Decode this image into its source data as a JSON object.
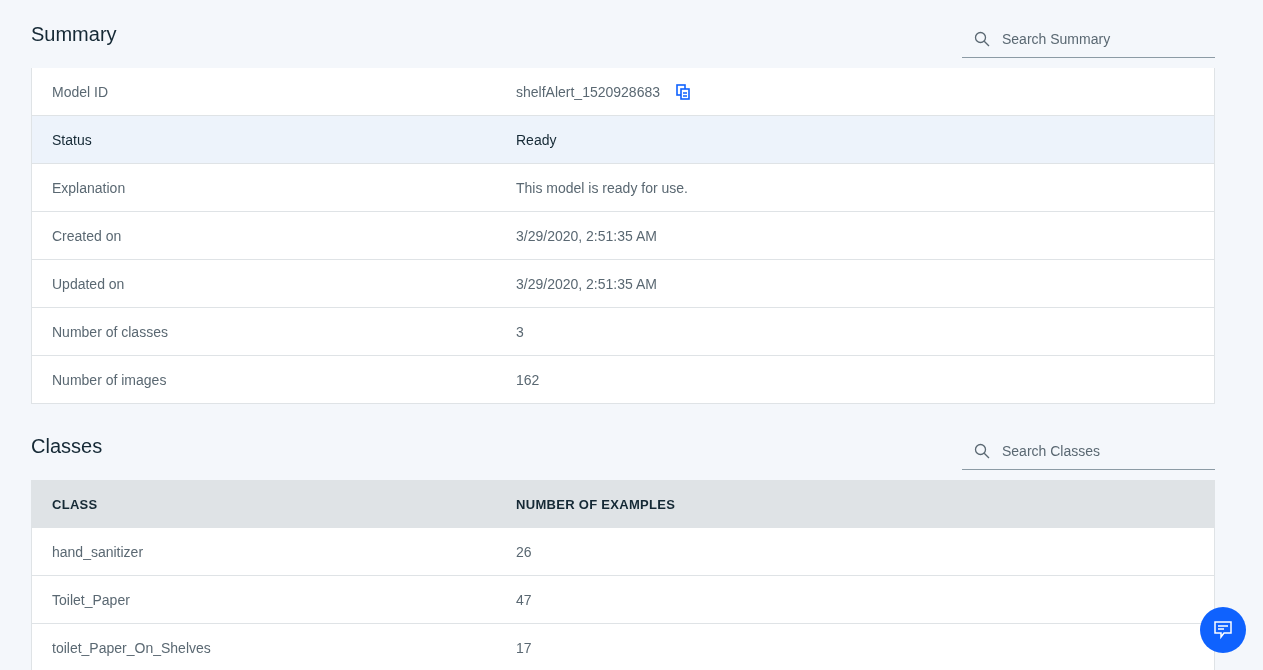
{
  "summary": {
    "title": "Summary",
    "search": {
      "placeholder": "Search Summary"
    },
    "rows": [
      {
        "label": "Model ID",
        "value": "shelfAlert_1520928683",
        "copyable": true,
        "selected": false
      },
      {
        "label": "Status",
        "value": "Ready",
        "copyable": false,
        "selected": true
      },
      {
        "label": "Explanation",
        "value": "This model is ready for use.",
        "copyable": false,
        "selected": false
      },
      {
        "label": "Created on",
        "value": "3/29/2020, 2:51:35 AM",
        "copyable": false,
        "selected": false
      },
      {
        "label": "Updated on",
        "value": "3/29/2020, 2:51:35 AM",
        "copyable": false,
        "selected": false
      },
      {
        "label": "Number of classes",
        "value": "3",
        "copyable": false,
        "selected": false
      },
      {
        "label": "Number of images",
        "value": "162",
        "copyable": false,
        "selected": false
      }
    ]
  },
  "classes": {
    "title": "Classes",
    "search": {
      "placeholder": "Search Classes"
    },
    "columns": [
      "CLASS",
      "NUMBER OF EXAMPLES"
    ],
    "rows": [
      [
        "hand_sanitizer",
        "26"
      ],
      [
        "Toilet_Paper",
        "47"
      ],
      [
        "toilet_Paper_On_Shelves",
        "17"
      ]
    ]
  }
}
